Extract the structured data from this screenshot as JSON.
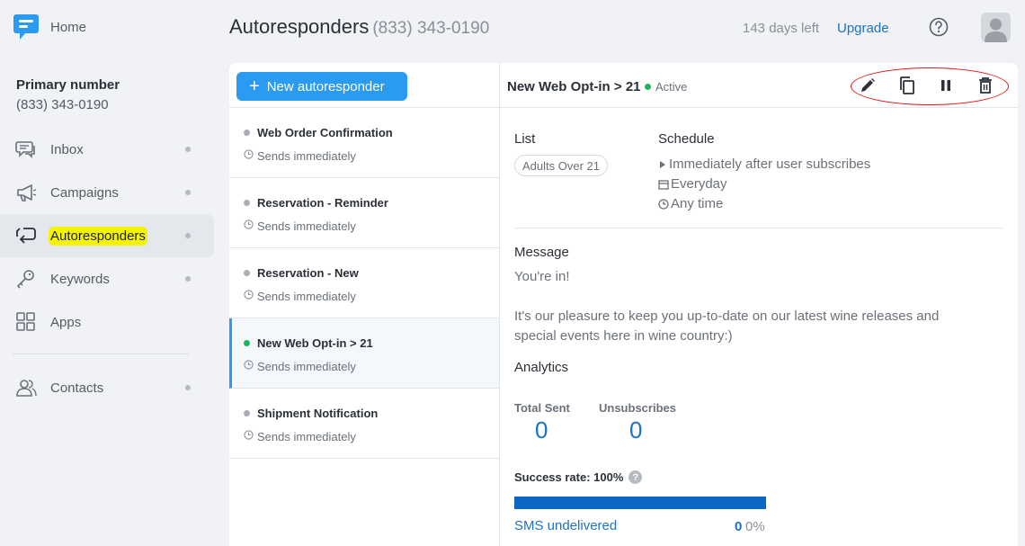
{
  "sidebar": {
    "home_label": "Home",
    "primary_title": "Primary number",
    "primary_number": "(833) 343-0190",
    "items": [
      {
        "label": "Inbox"
      },
      {
        "label": "Campaigns"
      },
      {
        "label": "Autoresponders"
      },
      {
        "label": "Keywords"
      },
      {
        "label": "Apps"
      },
      {
        "label": "Contacts"
      }
    ],
    "active_item": "Autoresponders"
  },
  "header": {
    "title": "Autoresponders",
    "number": "(833) 343-0190",
    "days_left": "143 days left",
    "upgrade": "Upgrade"
  },
  "list": {
    "new_button": "New autoresponder",
    "items": [
      {
        "name": "Web Order Confirmation",
        "sub": "Sends immediately",
        "status": "inactive"
      },
      {
        "name": "Reservation - Reminder",
        "sub": "Sends immediately",
        "status": "inactive"
      },
      {
        "name": "Reservation - New",
        "sub": "Sends immediately",
        "status": "inactive"
      },
      {
        "name": "New Web Opt-in > 21",
        "sub": "Sends immediately",
        "status": "active"
      },
      {
        "name": "Shipment Notification",
        "sub": "Sends immediately",
        "status": "inactive"
      }
    ]
  },
  "detail": {
    "title": "New Web Opt-in > 21",
    "status": "Active",
    "list_label": "List",
    "list_chip": "Adults Over 21",
    "schedule_label": "Schedule",
    "schedule": [
      "Immediately after user subscribes",
      "Everyday",
      "Any time"
    ],
    "message_label": "Message",
    "message_line1": "You're in!",
    "message_line2": "It's our pleasure to keep you up-to-date on our latest wine releases and",
    "message_line3": "special events here in wine country:)",
    "analytics_label": "Analytics",
    "total_sent_label": "Total Sent",
    "total_sent": "0",
    "unsub_label": "Unsubscribes",
    "unsub": "0",
    "success_rate": "Success rate: 100%",
    "success_fraction": 1.0,
    "undelivered_label": "SMS undelivered",
    "undelivered_count": "0",
    "undelivered_pct": "0%"
  },
  "colors": {
    "accent": "#2a9bf0",
    "link": "#1a73c9",
    "active_green": "#19b65a",
    "highlight": "#f4f400",
    "annotation_red": "#e0161b"
  }
}
